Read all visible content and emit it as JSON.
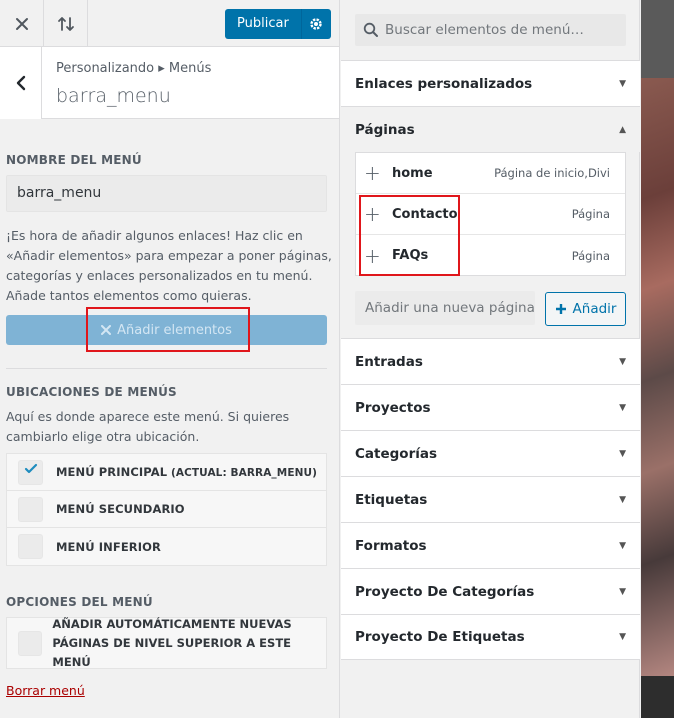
{
  "topbar": {
    "publish_label": "Publicar"
  },
  "header": {
    "breadcrumb": "Personalizando ▸ Menús",
    "title": "barra_menu"
  },
  "menu_name": {
    "label": "NOMBRE DEL MENÚ",
    "value": "barra_menu"
  },
  "intro_text": "¡Es hora de añadir algunos enlaces! Haz clic en «Añadir elementos» para empezar a poner páginas, categorías y enlaces personalizados en tu menú. Añade tantos elementos como quieras.",
  "add_items_label": "Añadir elementos",
  "locations": {
    "label": "UBICACIONES DE MENÚS",
    "desc": "Aquí es donde aparece este menú. Si quieres cambiarlo elige otra ubicación.",
    "items": [
      {
        "label": "MENÚ PRINCIPAL",
        "sub": " (ACTUAL: BARRA_MENU)",
        "checked": true
      },
      {
        "label": "MENÚ SECUNDARIO",
        "sub": "",
        "checked": false
      },
      {
        "label": "MENÚ INFERIOR",
        "sub": "",
        "checked": false
      }
    ]
  },
  "options": {
    "label": "OPCIONES DEL MENÚ",
    "auto_add_line1": "AÑADIR AUTOMÁTICAMENTE NUEVAS",
    "auto_add_line2": "PÁGINAS DE NIVEL SUPERIOR A ESTE MENÚ"
  },
  "delete_label": "Borrar menú",
  "search": {
    "placeholder": "Buscar elementos de menú…"
  },
  "accordions": {
    "custom_links": "Enlaces personalizados",
    "pages": "Páginas",
    "posts": "Entradas",
    "projects": "Proyectos",
    "categories": "Categorías",
    "tags": "Etiquetas",
    "formats": "Formatos",
    "project_categories": "Proyecto De Categorías",
    "project_tags": "Proyecto De Etiquetas"
  },
  "pages": [
    {
      "name": "home",
      "type": "Página de inicio,Divi"
    },
    {
      "name": "Contacto",
      "type": "Página"
    },
    {
      "name": "FAQs",
      "type": "Página"
    }
  ],
  "new_page": {
    "placeholder": "Añadir una nueva página",
    "add_label": "Añadir"
  },
  "colors": {
    "accent": "#0073aa",
    "highlight": "#e0161b",
    "delete": "#aa0000"
  }
}
